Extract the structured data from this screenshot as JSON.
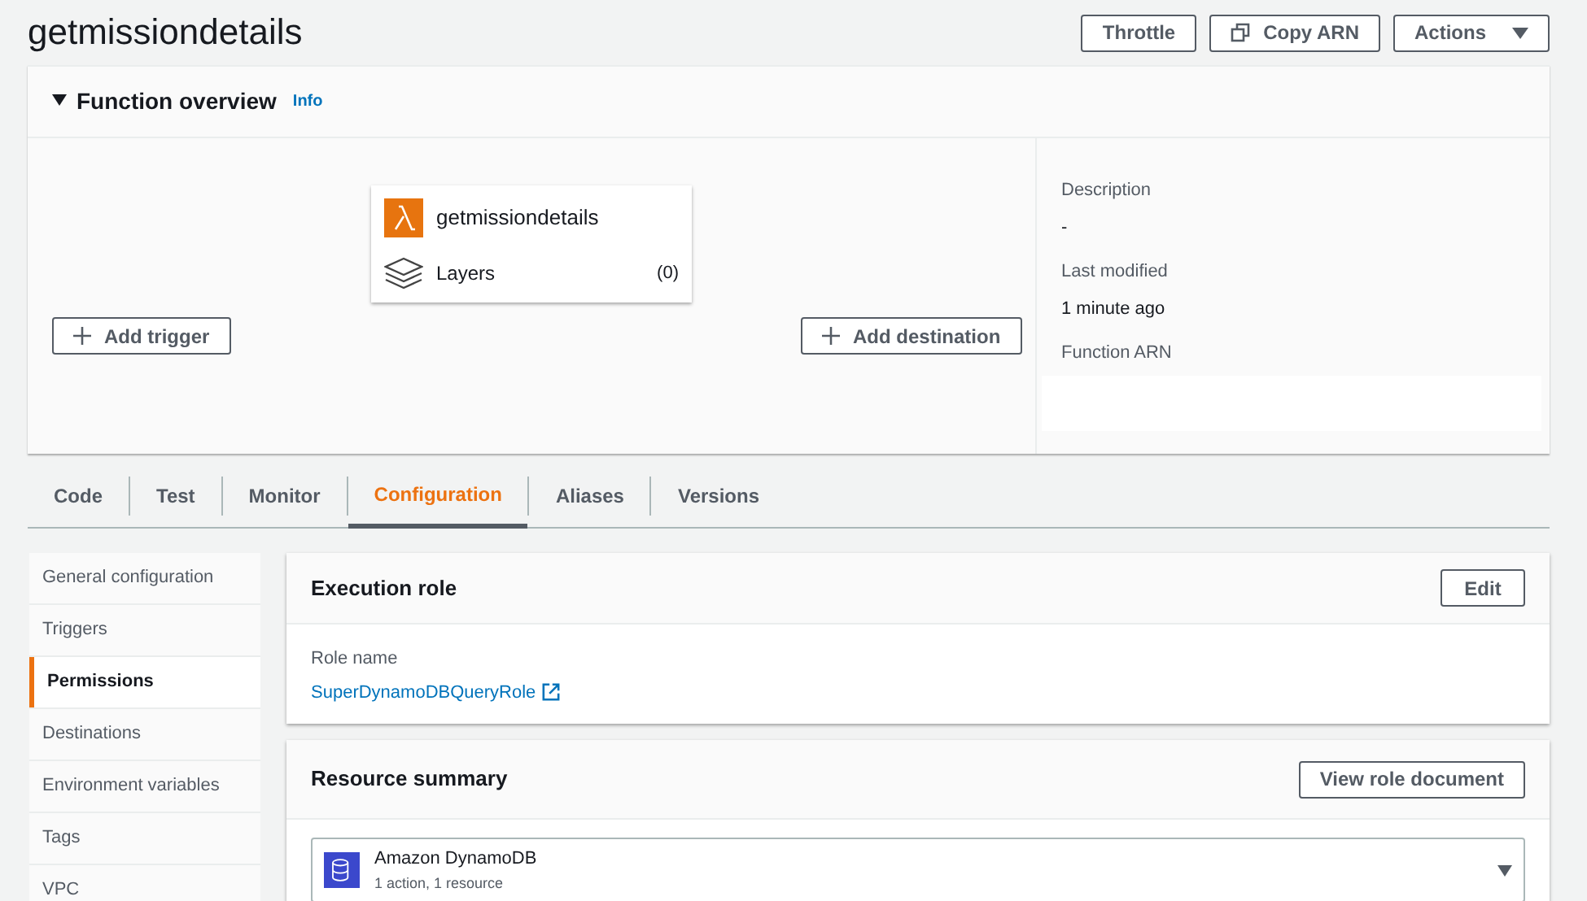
{
  "page_title": "getmissiondetails",
  "header_buttons": [
    {
      "label": "Throttle",
      "kind": "plain"
    },
    {
      "label": "Copy ARN",
      "kind": "copy"
    },
    {
      "label": "Actions",
      "kind": "dropdown"
    }
  ],
  "function_overview": {
    "title": "Function overview",
    "expanded": true,
    "info_link": "Info",
    "function_name": "getmissiondetails",
    "layers_label": "Layers",
    "layers_count": "(0)",
    "add_trigger": "Add trigger",
    "add_destination": "Add destination",
    "details": [
      {
        "label": "Description",
        "value": "-",
        "kind": "text"
      },
      {
        "label": "Last modified",
        "value": "1 minute ago",
        "kind": "text"
      },
      {
        "label": "Function ARN",
        "kind": "redacted"
      }
    ]
  },
  "tabs": [
    {
      "label": "Code",
      "selected": false
    },
    {
      "label": "Test",
      "selected": false
    },
    {
      "label": "Monitor",
      "selected": false
    },
    {
      "label": "Configuration",
      "selected": true
    },
    {
      "label": "Aliases",
      "selected": false
    },
    {
      "label": "Versions",
      "selected": false
    }
  ],
  "sidebar": {
    "items": [
      {
        "label": "General configuration",
        "selected": false
      },
      {
        "label": "Triggers",
        "selected": false
      },
      {
        "label": "Permissions",
        "selected": true
      },
      {
        "label": "Destinations",
        "selected": false
      },
      {
        "label": "Environment variables",
        "selected": false
      },
      {
        "label": "Tags",
        "selected": false
      },
      {
        "label": "VPC",
        "selected": false
      }
    ]
  },
  "execution_role": {
    "title": "Execution role",
    "edit_button": "Edit",
    "role_name_label": "Role name",
    "role_name": "SuperDynamoDBQueryRole"
  },
  "resource_summary": {
    "title": "Resource summary",
    "button": "View role document",
    "selector": {
      "service": "Amazon DynamoDB",
      "detail": "1 action, 1 resource"
    }
  }
}
